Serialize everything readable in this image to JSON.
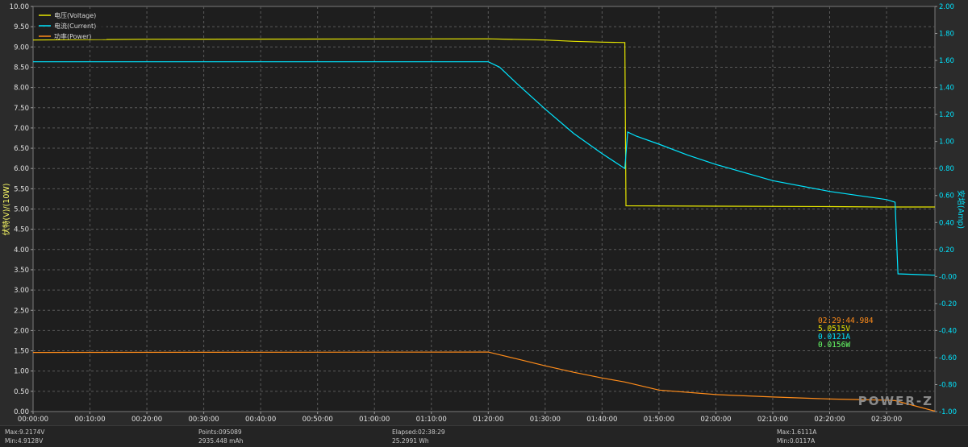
{
  "chart_data": {
    "type": "line",
    "legend": {
      "placement": "top-left",
      "items": [
        "电压(Voltage)",
        "电流(Current)",
        "功率(Power)"
      ]
    },
    "yaxis_left": {
      "label": "伏特(V)/(10W)",
      "ylim": [
        0,
        10
      ],
      "ticks": [
        "0.00",
        "0.50",
        "1.00",
        "1.50",
        "2.00",
        "2.50",
        "3.00",
        "3.50",
        "4.00",
        "4.50",
        "5.00",
        "5.50",
        "6.00",
        "6.50",
        "7.00",
        "7.50",
        "8.00",
        "8.50",
        "9.00",
        "9.50",
        "10.00"
      ]
    },
    "yaxis_right": {
      "label": "安培(Amp)",
      "ylim": [
        -1,
        2
      ],
      "ticks": [
        "-1.00",
        "-0.80",
        "-0.60",
        "-0.40",
        "-0.20",
        "-0.00",
        "0.20",
        "0.40",
        "0.60",
        "0.80",
        "1.00",
        "1.20",
        "1.40",
        "1.60",
        "1.80",
        "2.00"
      ]
    },
    "xaxis": {
      "ticks": [
        "00:00:00",
        "00:10:00",
        "00:20:00",
        "00:30:00",
        "00:40:00",
        "00:50:00",
        "01:00:00",
        "01:10:00",
        "01:20:00",
        "01:30:00",
        "01:40:00",
        "01:50:00",
        "02:00:00",
        "02:10:00",
        "02:20:00",
        "02:30:00"
      ]
    },
    "grid": true,
    "series": [
      {
        "name": "电压(Voltage)",
        "color": "#e6e600",
        "axis": "left",
        "x_minutes": [
          0,
          20,
          80,
          90,
          95,
          100,
          104,
          104.2,
          120,
          140,
          150,
          155,
          158.5
        ],
        "values": [
          9.17,
          9.19,
          9.2,
          9.17,
          9.14,
          9.12,
          9.11,
          5.08,
          5.07,
          5.06,
          5.05,
          5.05,
          5.05
        ]
      },
      {
        "name": "电流(Current)",
        "color": "#00e5ff",
        "axis": "right",
        "x_minutes": [
          0,
          80,
          82,
          85,
          90,
          95,
          100,
          104,
          104.5,
          106,
          110,
          115,
          120,
          130,
          140,
          150,
          151.5,
          152,
          158.5
        ],
        "values": [
          1.59,
          1.59,
          1.55,
          1.43,
          1.24,
          1.06,
          0.91,
          0.8,
          1.07,
          1.04,
          0.98,
          0.9,
          0.83,
          0.71,
          0.63,
          0.57,
          0.55,
          0.02,
          0.01
        ]
      },
      {
        "name": "功率(Power)",
        "color": "#ff8c1a",
        "axis": "left",
        "x_minutes": [
          0,
          80,
          85,
          90,
          95,
          100,
          104,
          110,
          120,
          130,
          140,
          150,
          151.5,
          158.5
        ],
        "values": [
          1.46,
          1.47,
          1.3,
          1.13,
          0.97,
          0.83,
          0.73,
          0.53,
          0.42,
          0.36,
          0.31,
          0.28,
          0.27,
          0.01
        ]
      }
    ],
    "cursor": {
      "time": "02:29:44.984",
      "voltage": "5.0515V",
      "current": "0.0121A",
      "power": "0.0156W"
    },
    "watermark": "POWER-Z"
  },
  "status": {
    "max_v": "Max:9.2174V",
    "min_v": "Min:4.9128V",
    "points": "Points:095089",
    "mah": "2935.448 mAh",
    "elapsed": "Elapsed:02:38:29",
    "wh": "25.2991 Wh",
    "max_a": "Max:1.6111A",
    "min_a": "Min:0.0117A"
  }
}
